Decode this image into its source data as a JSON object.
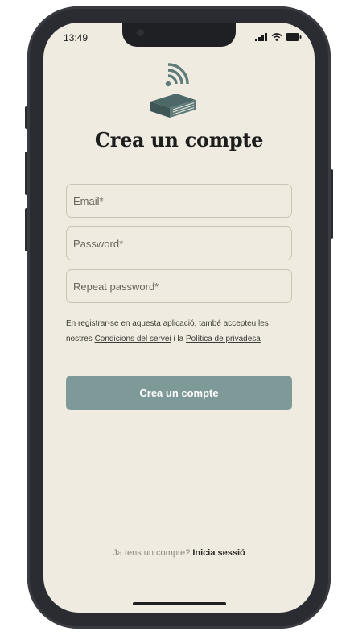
{
  "status_bar": {
    "time": "13:49",
    "icons": [
      "signal-icon",
      "wifi-icon",
      "battery-icon"
    ]
  },
  "logo": {
    "name": "book-wifi-logo",
    "colors": {
      "wifi": "#5f7b7a",
      "book": "#4d6967"
    }
  },
  "page": {
    "title": "Crea un compte"
  },
  "form": {
    "email_placeholder": "Email*",
    "password_placeholder": "Password*",
    "repeat_password_placeholder": "Repeat password*",
    "terms_prefix": "En registrar-se en aquesta aplicació, també accepteu les nostres ",
    "terms_link": "Condicions del servei",
    "terms_middle": " i la ",
    "privacy_link": "Política de privadesa",
    "submit_label": "Crea un compte"
  },
  "footer": {
    "has_account_text": "Ja tens un compte?",
    "sign_in_link": "Inicia sessió"
  },
  "colors": {
    "background": "#efebe1",
    "primary_button": "#7d9a98",
    "frame": "#2b2c31"
  }
}
